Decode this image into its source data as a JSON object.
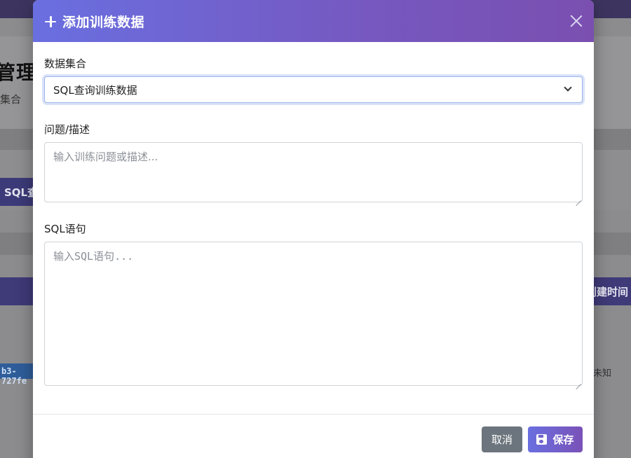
{
  "background": {
    "title": "管理",
    "subtitle": "集合",
    "sql_chip": "SQL查",
    "table_header_right": "创建时间",
    "id_chip": "b3-727fe",
    "unknown_text": "未知"
  },
  "modal": {
    "title": "添加训练数据",
    "icon": "plus-icon",
    "close_icon": "close-icon",
    "collection": {
      "label": "数据集合",
      "selected": "SQL查询训练数据"
    },
    "question": {
      "label": "问题/描述",
      "placeholder": "输入训练问题或描述...",
      "value": ""
    },
    "sql": {
      "label": "SQL语句",
      "placeholder": "输入SQL语句...",
      "value": ""
    },
    "buttons": {
      "cancel": "取消",
      "save": "保存"
    }
  },
  "colors": {
    "header_start": "#6a6fe0",
    "header_end": "#7a4fb0",
    "cancel_button": "#6c757d",
    "focus_border": "#9bb7ea"
  }
}
